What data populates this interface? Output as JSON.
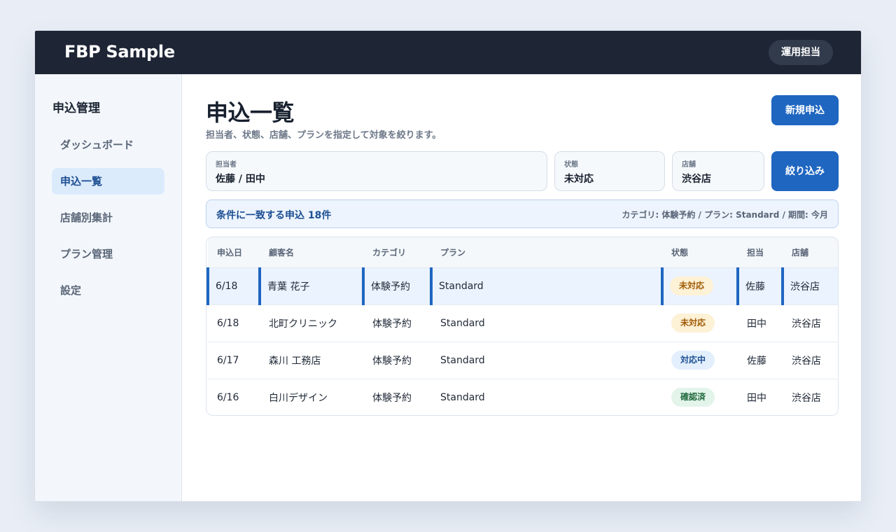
{
  "app": {
    "brand": "FBP Sample",
    "role": "運用担当"
  },
  "sidebar": {
    "title": "申込管理",
    "items": [
      {
        "label": "ダッシュボード",
        "active": false
      },
      {
        "label": "申込一覧",
        "active": true
      },
      {
        "label": "店舗別集計",
        "active": false
      },
      {
        "label": "プラン管理",
        "active": false
      },
      {
        "label": "設定",
        "active": false
      }
    ]
  },
  "page": {
    "title": "申込一覧",
    "description": "担当者、状態、店舗、プランを指定して対象を絞ります。",
    "new_button": "新規申込"
  },
  "filters": {
    "assignee": {
      "label": "担当者",
      "value": "佐藤 / 田中"
    },
    "status": {
      "label": "状態",
      "value": "未対応"
    },
    "store": {
      "label": "店舗",
      "value": "渋谷店"
    },
    "apply_button": "絞り込み"
  },
  "summary": {
    "count_text": "条件に一致する申込 18件",
    "conditions": "カテゴリ: 体験予約 / プラン: Standard / 期間: 今月"
  },
  "table": {
    "columns": [
      "申込日",
      "顧客名",
      "カテゴリ",
      "プラン",
      "状態",
      "担当",
      "店舗"
    ],
    "rows": [
      {
        "date": "6/18",
        "customer": "青葉 花子",
        "category": "体験予約",
        "plan": "Standard",
        "status": "未対応",
        "status_kind": "pending",
        "assignee": "佐藤",
        "store": "渋谷店",
        "selected": true
      },
      {
        "date": "6/18",
        "customer": "北町クリニック",
        "category": "体験予約",
        "plan": "Standard",
        "status": "未対応",
        "status_kind": "pending",
        "assignee": "田中",
        "store": "渋谷店",
        "selected": false
      },
      {
        "date": "6/17",
        "customer": "森川 工務店",
        "category": "体験予約",
        "plan": "Standard",
        "status": "対応中",
        "status_kind": "in_progress",
        "assignee": "佐藤",
        "store": "渋谷店",
        "selected": false
      },
      {
        "date": "6/16",
        "customer": "白川デザイン",
        "category": "体験予約",
        "plan": "Standard",
        "status": "確認済",
        "status_kind": "confirmed",
        "assignee": "田中",
        "store": "渋谷店",
        "selected": false
      }
    ]
  },
  "colors": {
    "accent": "#1f66c1",
    "topbar": "#1e2636",
    "pending_bg": "#fdf1d6",
    "pending_fg": "#a15c07",
    "in_progress_bg": "#e3effd",
    "in_progress_fg": "#1d4f93",
    "confirmed_bg": "#e3f4ea",
    "confirmed_fg": "#216a3d"
  }
}
